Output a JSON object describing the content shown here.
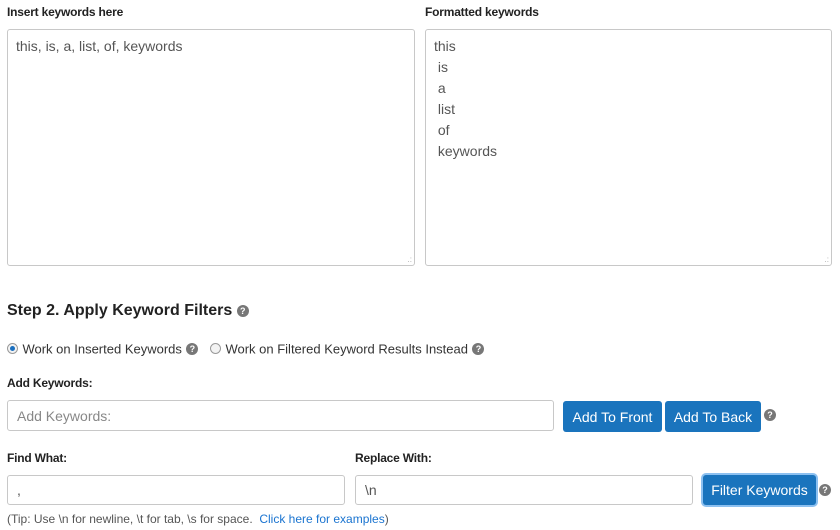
{
  "step1": {
    "input_label": "Insert keywords here",
    "input_value": "this, is, a, list, of, keywords",
    "output_label": "Formatted keywords",
    "output_lines": [
      "this",
      " is",
      " a",
      " list",
      " of",
      " keywords"
    ]
  },
  "step2": {
    "title": "Step 2. Apply Keyword Filters",
    "radio_options": [
      {
        "label": "Work on Inserted Keywords",
        "checked": true
      },
      {
        "label": "Work on Filtered Keyword Results Instead",
        "checked": false
      }
    ],
    "add_keywords": {
      "label": "Add Keywords:",
      "placeholder": "Add Keywords:",
      "add_front_label": "Add To Front",
      "add_back_label": "Add To Back"
    },
    "find": {
      "label": "Find What:",
      "value": ","
    },
    "replace": {
      "label": "Replace With:",
      "value": "\\n"
    },
    "filter_button_label": "Filter Keywords",
    "tip_prefix": "(Tip: Use \\n for newline, \\t for tab, \\s for space.  ",
    "tip_link": "Click here for examples",
    "tip_suffix": ")"
  },
  "icons": {
    "help": "question-circle-icon",
    "resize": "resize-grip-icon"
  },
  "colors": {
    "primary_button": "#1a74bd",
    "link": "#1a74d0",
    "radio_selected": "#1a6fbf"
  }
}
